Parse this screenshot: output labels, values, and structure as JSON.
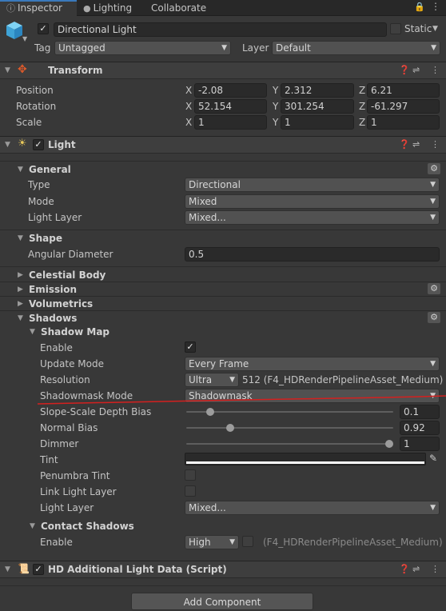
{
  "tabs": [
    {
      "label": "Inspector",
      "icon": "info-icon"
    },
    {
      "label": "Lighting",
      "icon": "bulb-icon"
    },
    {
      "label": "Collaborate"
    }
  ],
  "gameobject": {
    "name": "Directional Light",
    "static_label": "Static",
    "tag_label": "Tag",
    "tag_value": "Untagged",
    "layer_label": "Layer",
    "layer_value": "Default"
  },
  "transform": {
    "title": "Transform",
    "position": {
      "label": "Position",
      "x": "-2.08",
      "y": "2.312",
      "z": "6.21"
    },
    "rotation": {
      "label": "Rotation",
      "x": "52.154",
      "y": "301.254",
      "z": "-61.297"
    },
    "scale": {
      "label": "Scale",
      "x": "1",
      "y": "1",
      "z": "1"
    }
  },
  "light": {
    "title": "Light",
    "general": {
      "title": "General",
      "type_label": "Type",
      "type_value": "Directional",
      "mode_label": "Mode",
      "mode_value": "Mixed",
      "light_layer_label": "Light Layer",
      "light_layer_value": "Mixed..."
    },
    "shape": {
      "title": "Shape",
      "angular_label": "Angular Diameter",
      "angular_value": "0.5"
    },
    "celestial_title": "Celestial Body",
    "emission_title": "Emission",
    "volumetrics_title": "Volumetrics",
    "shadows_title": "Shadows",
    "shadow_map": {
      "title": "Shadow Map",
      "enable_label": "Enable",
      "enable_checked": true,
      "update_mode_label": "Update Mode",
      "update_mode_value": "Every Frame",
      "resolution_label": "Resolution",
      "resolution_value": "Ultra",
      "resolution_note": "512 (F4_HDRenderPipelineAsset_Medium)",
      "shadowmask_label": "Shadowmask Mode",
      "shadowmask_value": "Shadowmask",
      "slope_label": "Slope-Scale Depth Bias",
      "slope_value": "0.1",
      "slope_fraction": 0.1,
      "normal_label": "Normal Bias",
      "normal_value": "0.92",
      "normal_fraction": 0.2,
      "dimmer_label": "Dimmer",
      "dimmer_value": "1",
      "dimmer_fraction": 1.0,
      "tint_label": "Tint",
      "penumbra_label": "Penumbra Tint",
      "penumbra_checked": false,
      "link_label": "Link Light Layer",
      "link_checked": false,
      "layer_label": "Light Layer",
      "layer_value": "Mixed..."
    },
    "contact": {
      "title": "Contact Shadows",
      "enable_label": "Enable",
      "enable_value": "High",
      "enable_note": "(F4_HDRenderPipelineAsset_Medium)"
    }
  },
  "hd_data": {
    "title": "HD Additional Light Data (Script)"
  },
  "add_component": "Add Component",
  "colors": {
    "accent": "#3a79bb",
    "annotation": "#d4201f",
    "tint": "#ffffff"
  }
}
